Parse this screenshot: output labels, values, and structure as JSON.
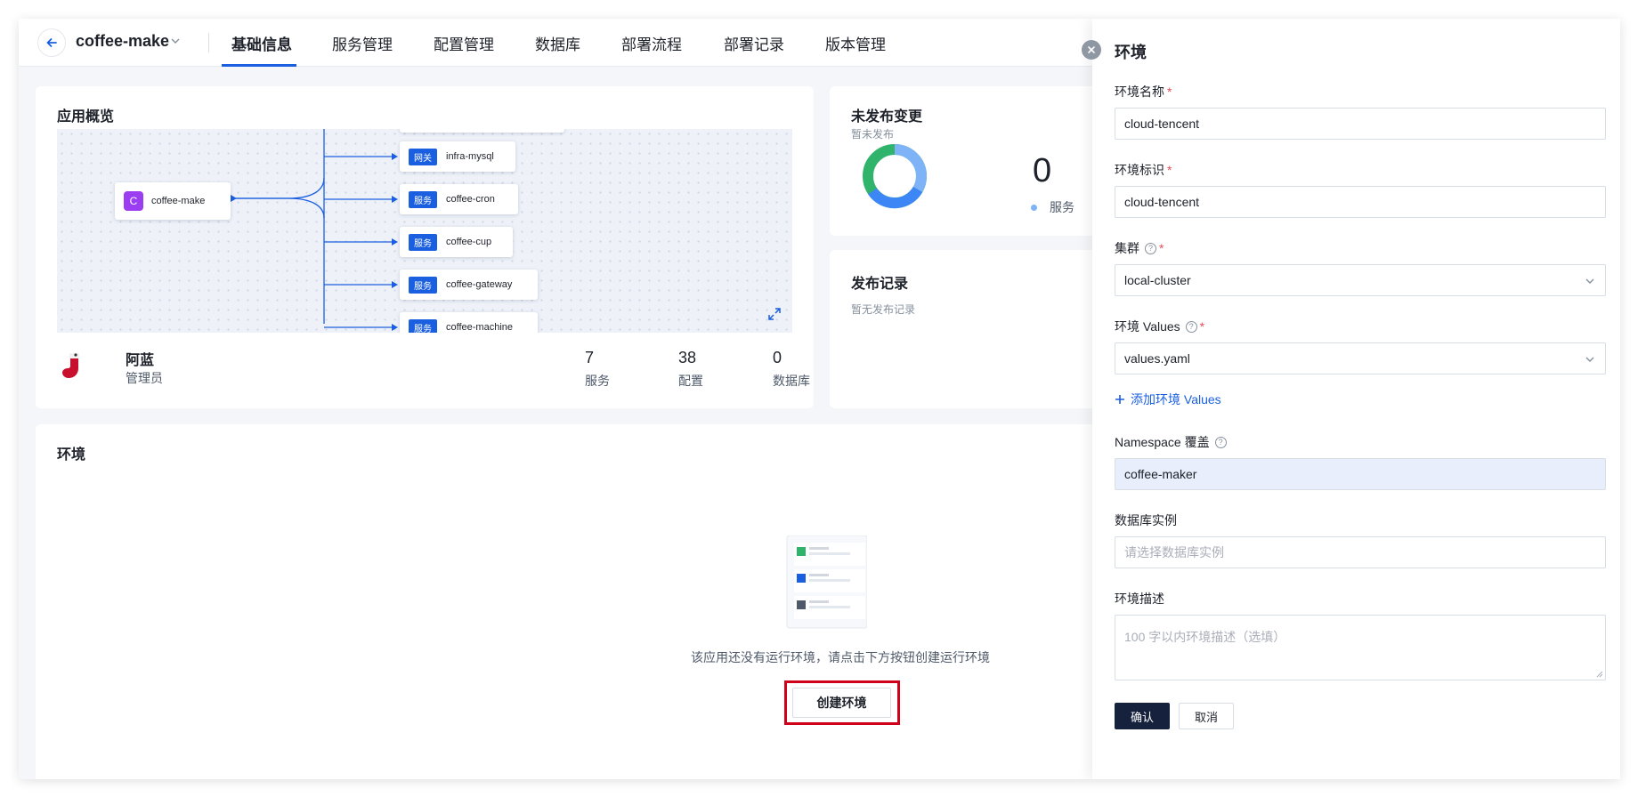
{
  "header": {
    "app_name": "coffee-make",
    "tabs": [
      "基础信息",
      "服务管理",
      "配置管理",
      "数据库",
      "部署流程",
      "部署记录",
      "版本管理"
    ],
    "active_tab": "基础信息"
  },
  "overview": {
    "title": "应用概览",
    "root_icon_letter": "C",
    "root_name": "coffee-make",
    "nodes": [
      {
        "badge": "网关",
        "name": "infra-mysql"
      },
      {
        "badge": "服务",
        "name": "coffee-cron"
      },
      {
        "badge": "服务",
        "name": "coffee-cup"
      },
      {
        "badge": "服务",
        "name": "coffee-gateway"
      },
      {
        "badge": "服务",
        "name": "coffee-machine"
      }
    ],
    "owner_name": "阿蓝",
    "owner_role": "管理员",
    "stats": [
      {
        "value": "7",
        "label": "服务"
      },
      {
        "value": "38",
        "label": "配置"
      },
      {
        "value": "0",
        "label": "数据库"
      }
    ]
  },
  "unreleased": {
    "title": "未发布变更",
    "subtitle": "暂未发布",
    "count": "0",
    "legend": "服务",
    "colors": {
      "primary": "#3d86f5",
      "light": "#7fb3f7",
      "green": "#30b46b"
    }
  },
  "release_records": {
    "title": "发布记录",
    "empty": "暂无发布记录"
  },
  "environment": {
    "title": "环境",
    "empty_text": "该应用还没有运行环境，请点击下方按钮创建运行环境",
    "create_button": "创建环境",
    "highlight_color": "#d0021b"
  },
  "drawer": {
    "title": "环境",
    "env_name_label": "环境名称",
    "env_name_value": "cloud-tencent",
    "env_id_label": "环境标识",
    "env_id_value": "cloud-tencent",
    "cluster_label": "集群",
    "cluster_value": "local-cluster",
    "values_label": "环境 Values",
    "values_value": "values.yaml",
    "add_values": "添加环境 Values",
    "namespace_label": "Namespace 覆盖",
    "namespace_value": "coffee-maker",
    "db_label": "数据库实例",
    "db_placeholder": "请选择数据库实例",
    "desc_label": "环境描述",
    "desc_placeholder": "100 字以内环境描述（选填）",
    "confirm": "确认",
    "cancel": "取消"
  }
}
